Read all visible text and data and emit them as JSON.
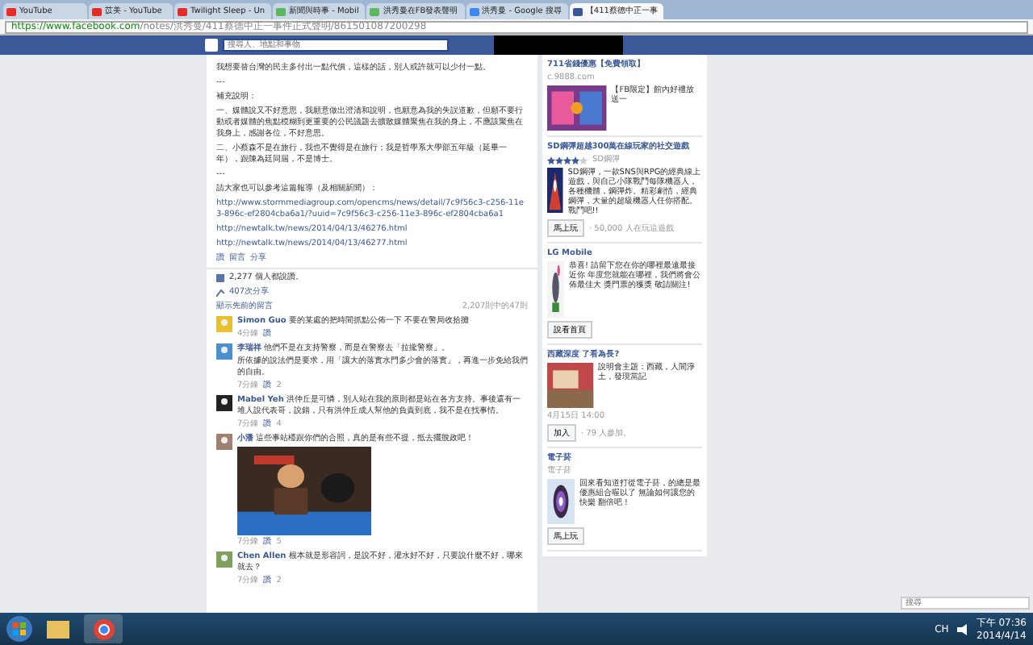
{
  "browser": {
    "tabs": [
      {
        "title": "YouTube",
        "selected": false
      },
      {
        "title": "苡美 - YouTube",
        "selected": false
      },
      {
        "title": "Twilight Sleep - Un",
        "selected": false
      },
      {
        "title": "新聞與時事 - Mobil",
        "selected": false
      },
      {
        "title": "洪秀曼在FB發表聲明",
        "selected": false
      },
      {
        "title": "洪秀曼 - Google 搜尋",
        "selected": false
      },
      {
        "title": "【411蔡德中正一事",
        "selected": true
      }
    ],
    "url_host": "https://www.facebook.com",
    "url_path": "/notes/洪秀曼/411蔡德中正一事件正式聲明/861501087200298"
  },
  "facebook": {
    "search": {
      "placeholder": "搜尋人、地點和事物"
    }
  },
  "post": {
    "paragraphs": [
      "我想要替台灣的民主多付出一點代價，這樣的話，別人或許就可以少付一點。",
      "---",
      "補充說明：",
      "一、媒體說又不好意思，我願意做出澄清和說明，也願意為我的失誤道歉，但願不要行動或者媒體的焦點模糊到更重要的公民議題去擴散媒體聚焦在我的身上，不應該聚焦在我身上，感謝各位，不好意思。",
      "二、小蔡森不是在旅行，我也不覺得是在旅行；我是哲學系大學部五年級（延畢一年），跟陳為廷同屆，不是博士。",
      "---",
      "請大家也可以參考這篇報導（及相關新聞）："
    ],
    "links": [
      "http://www.stormmediagroup.com/opencms/news/detail/7c9f56c3-c256-11e3-896c-ef2804cba6a1/?uuid=7c9f56c3-c256-11e3-896c-ef2804cba6a1",
      "http://newtalk.tw/news/2014/04/13/46276.html",
      "http://newtalk.tw/news/2014/04/13/46277.html"
    ],
    "actions": [
      "讚",
      "留言",
      "分享"
    ],
    "likes": "2,277 個人都說讚。",
    "shares": "407次分享",
    "show_previous": "顯示先前的留言",
    "comment_count": "2,207則中的47則",
    "comments": [
      {
        "name": "Simon Guo",
        "text": "要的某處的把時間抓點公佈一下 不要在警局收拾攤",
        "time": "4分鐘",
        "like": "讚"
      },
      {
        "name": "李瑞祥",
        "text": "他們不是在支持警察，而是在警察去「拉攏警察」。",
        "extra": "所依據的說法們是要求，用「讓大的落實水門多少會的落實」，再進一步免給我們的自由。",
        "time": "7分鐘",
        "like": "讚",
        "like_count": "2"
      },
      {
        "name": "Mabel Yeh",
        "text": "洪仲丘是可憐，別人站在我的原則都是站在各方支持。事後還有一堆人說代表哥，說錯，只有洪仲丘成人幫他的負責到底，我不是在找事情。",
        "time": "7分鐘",
        "like": "讚",
        "like_count": "4"
      },
      {
        "name": "小潘",
        "text": "這些事站檯跟你們的合照，真的是有些不提，抵去擺脫政吧！",
        "kind": "picture",
        "time": "7分鐘",
        "like": "讚",
        "like_count": "5"
      },
      {
        "name": "Chen Allen",
        "text": "根本就是形容詞，是說不好，灌水好不好，只要說什麼不好，哪來就去？",
        "time": "7分鐘",
        "like": "讚",
        "like_count": "2"
      }
    ]
  },
  "sidebar": {
    "ads": [
      {
        "title": "711省錢優惠【免費領取】",
        "source": "c.9888.com",
        "text": "【FB限定】館內好禮放送一"
      },
      {
        "title": "SD鋼彈超越300萬在線玩家的社交遊戲",
        "text": "SD鋼彈，一款SNS與RPG的經典線上遊戲，與自己小隊戰鬥每隊機器人，各種機體，鋼彈炸。精彩劇情，經典鋼彈，大量的超級機器人任你搭配。戰鬥吧!!",
        "stars": 4,
        "rating": "SD鋼彈",
        "button": "馬上玩",
        "note": "· 50,000 人在玩這遊戲"
      },
      {
        "title": "LG Mobile",
        "text": "恭喜! 請留下您在你的哪裡最遠最接近你 年度您就能在哪裡，我們將會公佈最佳大 獎門票的獲獎 敬請關注!",
        "button": "說看首頁"
      },
      {
        "title": "西藏深度 了看為長?",
        "text": "說明會主題：西藏，人間淨土，發現當記",
        "button": "加入",
        "note": "· 79 人參加。",
        "date": "4月15日 14:00"
      },
      {
        "title": "電子菸",
        "source": "電子菸",
        "text": "回來看知道打從電子菸，的總是最優惠組合喔以了 無論如何讓您的快樂 翻倍吧！",
        "button": "馬上玩"
      }
    ]
  },
  "chat_search": {
    "placeholder": "搜尋"
  },
  "taskbar": {
    "language": "CH",
    "time": "下午 07:36",
    "date": "2014/4/14"
  }
}
